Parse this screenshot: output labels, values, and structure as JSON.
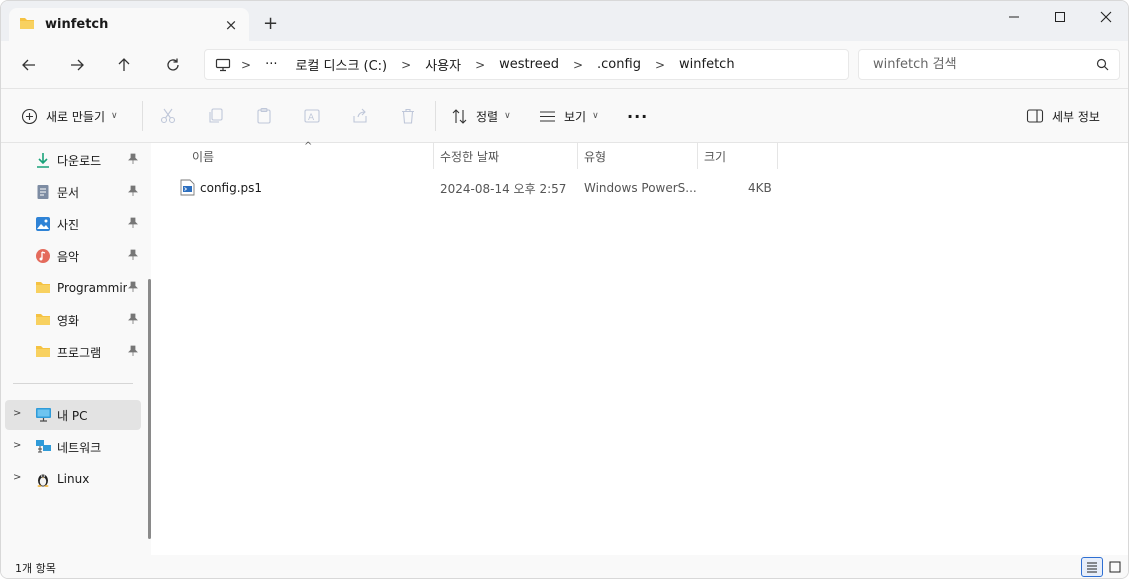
{
  "tab": {
    "title": "winfetch",
    "close_icon": "×",
    "new_tab_icon": "+"
  },
  "window_controls": {
    "minimize": "minimize-icon",
    "maximize": "maximize-icon",
    "close": "close-icon"
  },
  "nav": {
    "back": "back-arrow-icon",
    "forward": "forward-arrow-icon",
    "up": "up-arrow-icon",
    "refresh": "refresh-icon"
  },
  "breadcrumb": {
    "more": "···",
    "items": [
      "로컬 디스크 (C:)",
      "사용자",
      "westreed",
      ".config",
      "winfetch"
    ]
  },
  "search": {
    "placeholder": "winfetch 검색"
  },
  "toolbar": {
    "new_label": "새로 만들기",
    "sort_label": "정렬",
    "view_label": "보기",
    "more": "···",
    "details_label": "세부 정보"
  },
  "sidebar": {
    "quick_access": [
      {
        "label": "다운로드",
        "icon": "download-icon",
        "pinned": true
      },
      {
        "label": "문서",
        "icon": "document-icon",
        "pinned": true
      },
      {
        "label": "사진",
        "icon": "picture-icon",
        "pinned": true
      },
      {
        "label": "음악",
        "icon": "music-icon",
        "pinned": true
      },
      {
        "label": "Programmin",
        "icon": "folder-icon",
        "pinned": true
      },
      {
        "label": "영화",
        "icon": "folder-icon",
        "pinned": true
      },
      {
        "label": "프로그램",
        "icon": "folder-icon",
        "pinned": true
      }
    ],
    "locations": [
      {
        "label": "내 PC",
        "icon": "pc-icon",
        "selected": true
      },
      {
        "label": "네트워크",
        "icon": "network-icon",
        "selected": false
      },
      {
        "label": "Linux",
        "icon": "linux-icon",
        "selected": false
      }
    ]
  },
  "columns": {
    "name": "이름",
    "modified": "수정한 날짜",
    "type": "유형",
    "size": "크기"
  },
  "files": [
    {
      "name": "config.ps1",
      "modified": "2024-08-14 오후 2:57",
      "type": "Windows PowerS...",
      "size": "4KB"
    }
  ],
  "status": {
    "text": "1개 항목"
  },
  "colors": {
    "accent": "#2e6fd3",
    "folder": "#f5c242",
    "download": "#1aa37a"
  }
}
